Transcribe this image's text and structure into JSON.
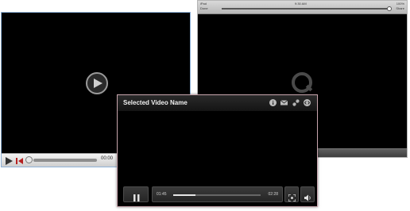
{
  "player_generic": {
    "time": "00:00"
  },
  "player_quicktime": {
    "top_left": "iPad",
    "top_center": "9:30 AM",
    "top_right": "100%",
    "row2_left": "Done",
    "row2_right": "Share"
  },
  "player_main": {
    "title": "Selected Video Name",
    "current_time": "01:45",
    "duration": "02:28",
    "progress": 0.25,
    "header_icons": [
      "info-icon",
      "email-icon",
      "link-icon",
      "embed-icon"
    ],
    "control_icons": [
      "pause-icon",
      "fullscreen-icon",
      "volume-icon"
    ]
  }
}
